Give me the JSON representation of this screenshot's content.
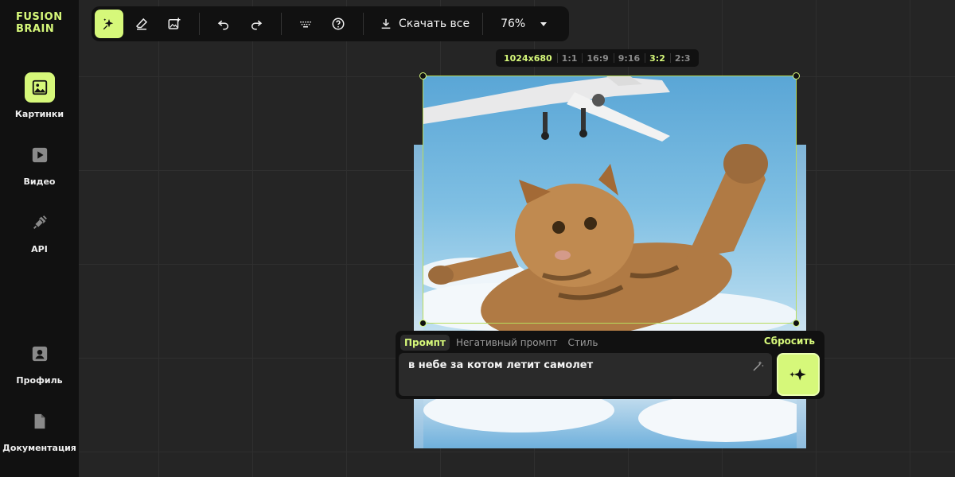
{
  "app": {
    "logo_line1": "FUSION",
    "logo_line2": "BRAIN",
    "accent_color": "#d6f87a"
  },
  "sidebar": {
    "items": [
      {
        "label": "Картинки",
        "icon": "image-icon",
        "active": true
      },
      {
        "label": "Видео",
        "icon": "play-icon",
        "active": false
      },
      {
        "label": "API",
        "icon": "plug-icon",
        "active": false
      },
      {
        "label": "Профиль",
        "icon": "profile-icon",
        "active": false
      },
      {
        "label": "Документация",
        "icon": "document-icon",
        "active": false
      }
    ]
  },
  "toolbar": {
    "tools": [
      "magic-generate-icon",
      "eraser-icon",
      "add-image-icon",
      "undo-icon",
      "redo-icon",
      "keyboard-icon",
      "help-icon"
    ],
    "download_label": "Скачать все",
    "zoom_value": "76%"
  },
  "ratios": {
    "size": "1024x680",
    "options": [
      "1:1",
      "16:9",
      "9:16",
      "3:2",
      "2:3"
    ],
    "selected": "3:2"
  },
  "prompt_panel": {
    "tabs": [
      "Промпт",
      "Негативный промпт",
      "Стиль"
    ],
    "active_tab": "Промпт",
    "reset_label": "Сбросить",
    "prompt_value": "в небе за котом летит самолет"
  },
  "canvas": {
    "image_description_icon": "generated-image"
  }
}
